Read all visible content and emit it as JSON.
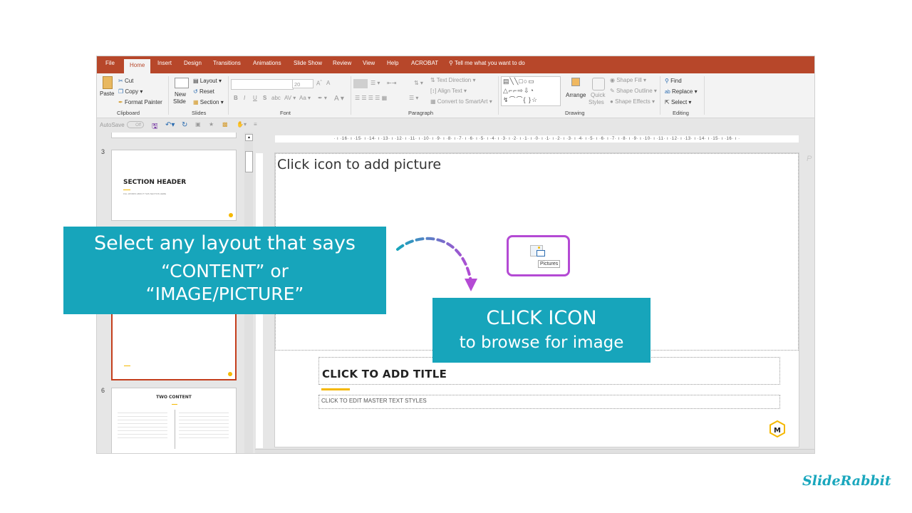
{
  "ribbon": {
    "tabs": [
      "File",
      "Home",
      "Insert",
      "Design",
      "Transitions",
      "Animations",
      "Slide Show",
      "Review",
      "View",
      "Help",
      "ACROBAT"
    ],
    "active_tab": "Home",
    "tell_me": "Tell me what you want to do",
    "clipboard": {
      "paste": "Paste",
      "cut": "Cut",
      "copy": "Copy",
      "format_painter": "Format Painter",
      "label": "Clipboard"
    },
    "slides": {
      "new_slide_1": "New",
      "new_slide_2": "Slide",
      "layout": "Layout",
      "reset": "Reset",
      "section": "Section",
      "label": "Slides"
    },
    "font": {
      "font_name": "",
      "font_size": "20",
      "bold": "B",
      "italic": "I",
      "underline": "U",
      "shadow": "S",
      "strike": "abc",
      "label": "Font"
    },
    "paragraph": {
      "text_direction": "Text Direction",
      "align_text": "Align Text",
      "convert_smartart": "Convert to SmartArt",
      "label": "Paragraph"
    },
    "drawing": {
      "arrange": "Arrange",
      "quick_styles_1": "Quick",
      "quick_styles_2": "Styles",
      "shape_fill": "Shape Fill",
      "shape_outline": "Shape Outline",
      "shape_effects": "Shape Effects",
      "label": "Drawing"
    },
    "editing": {
      "find": "Find",
      "replace": "Replace",
      "select": "Select",
      "label": "Editing"
    }
  },
  "qat": {
    "autosave": "AutoSave",
    "autosave_state": "Off"
  },
  "slide_panel": {
    "slides": [
      {
        "number": "3",
        "title": "SECTION HEADER",
        "subtitle": "FILL WORDS ABOUT THIS SECTION HERE"
      },
      {
        "number": "",
        "title": "",
        "subtitle": ""
      },
      {
        "number": "6",
        "title": "TWO CONTENT",
        "subtitle": ""
      }
    ]
  },
  "ruler": {
    "horizontal": "· ı ·16· ı ·15· ı ·14· ı ·13· ı ·12· ı ·11· ı ·10· ı ·9· ı ·8· ı ·7· ı ·6· ı ·5· ı ·4· ı ·3· ı ·2· ı ·1· ı ·0· ı ·1· ı ·2· ı ·3· ı ·4· ı ·5· ı ·6· ı ·7· ı ·8· ı ·9· ı ·10· ı ·11· ı ·12· ı ·13· ı ·14· ı ·15· ı ·16· ı ·"
  },
  "slide": {
    "picture_placeholder": "Click icon to add picture",
    "pictures_tooltip": "Pictures",
    "title_placeholder": "CLICK TO ADD TITLE",
    "body_placeholder": "CLICK TO EDIT MASTER TEXT STYLES"
  },
  "callouts": {
    "left": {
      "line1": "Select  any layout that says",
      "line2": "“CONTENT” or",
      "line3": "“IMAGE/PICTURE”"
    },
    "right": {
      "line1": "CLICK ICON",
      "line2": "to browse for image"
    }
  },
  "colors": {
    "ribbon_tab_bar": "#b7472a",
    "callout": "#17a5bb",
    "highlight": "#b44ad4",
    "accent": "#f5b800"
  },
  "brand": "SlideRabbit"
}
